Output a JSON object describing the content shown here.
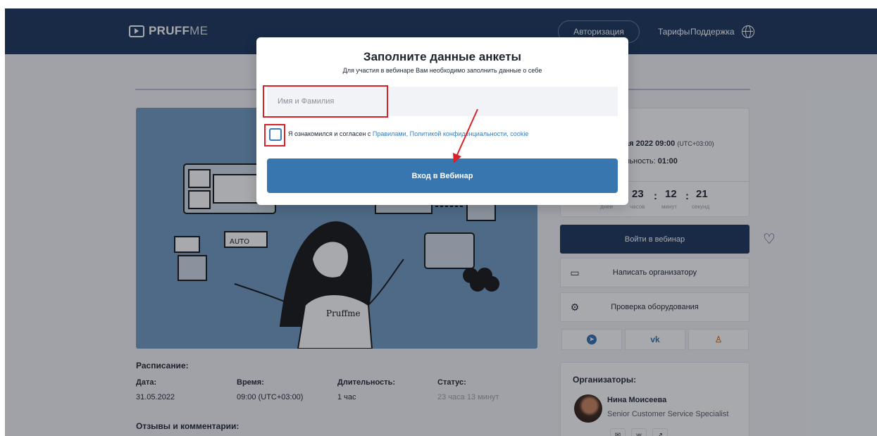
{
  "header": {
    "logo_prefix": "PRUFF",
    "logo_suffix": "ME",
    "auth_label": "Авторизация",
    "tariffs_label": "Тарифы",
    "support_label": "Поддержка"
  },
  "hero": {
    "badge_text": "Pruffme",
    "sticker_text": "AUTO"
  },
  "schedule": {
    "title": "Расписание:",
    "columns": [
      {
        "header": "Дата:",
        "value": "31.05.2022"
      },
      {
        "header": "Время:",
        "value": "09:00 (UTC+03:00)"
      },
      {
        "header": "Длительность:",
        "value": "1 час"
      },
      {
        "header": "Статус:",
        "value": "23 часа 13 минут"
      }
    ]
  },
  "reviews_title": "Отзывы и комментарии:",
  "event_info": {
    "date_line": "ая 2022 09:00",
    "tz": "(UTC+03:00)",
    "duration_prefix": "льность:",
    "duration_value": "01:00"
  },
  "countdown": {
    "hours": "23",
    "minutes": "12",
    "seconds": "21",
    "days_label": "дней",
    "hours_label": "часов",
    "minutes_label": "минут",
    "seconds_label": "секунд"
  },
  "actions": {
    "enter_label": "Войти в вебинар",
    "message_label": "Написать организатору",
    "check_label": "Проверка оборудования"
  },
  "social": {
    "vk_label": "vk"
  },
  "organizers": {
    "title": "Организаторы:",
    "name": "Нина Моисеева",
    "role": "Senior Customer Service Specialist"
  },
  "modal": {
    "title": "Заполните данные анкеты",
    "subtitle": "Для участия в вебинаре Вам необходимо заполнить данные о себе",
    "name_placeholder": "Имя и Фамилия",
    "consent_prefix": "Я ознакомился и согласен с ",
    "consent_links": "Правилами, Политикой конфиденциальности, cookie",
    "submit_label": "Вход в Вебинар"
  },
  "colors": {
    "header_bg": "#17335a",
    "hero_bg": "#6e9ac0",
    "primary_button": "#3776ae",
    "annotation_red": "#d8212a"
  }
}
